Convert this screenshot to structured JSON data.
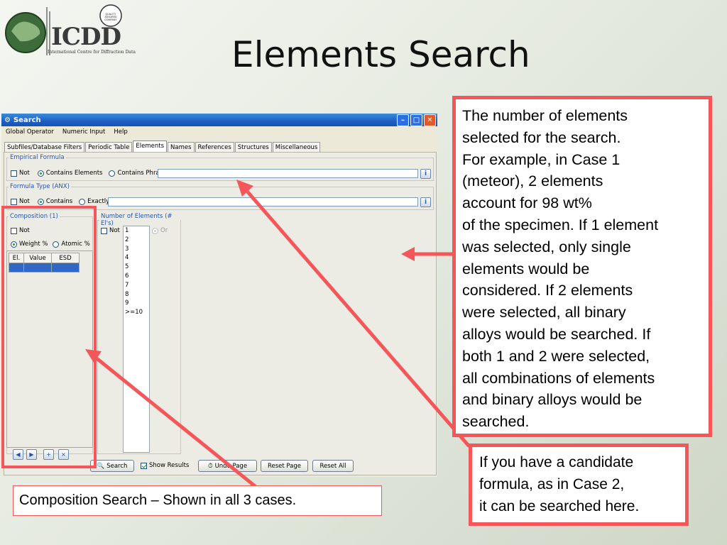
{
  "slide": {
    "title": "Elements Search",
    "logo": {
      "text": "ICDD",
      "subtitle": "International Centre for Diffraction Data",
      "badge": "QUALITY ASSURED COMPANY"
    }
  },
  "window": {
    "title": "Search",
    "menu": [
      "Global Operator",
      "Numeric Input",
      "Help"
    ],
    "tabs": [
      "Subfiles/Database Filters",
      "Periodic Table",
      "Elements",
      "Names",
      "References",
      "Structures",
      "Miscellaneous"
    ],
    "active_tab": "Elements",
    "empirical": {
      "legend": "Empirical Formula",
      "not_label": "Not",
      "contains_elements_label": "Contains Elements",
      "contains_phrase_label": "Contains Phrase",
      "value": ""
    },
    "formula_type": {
      "legend": "Formula Type (ANX)",
      "not_label": "Not",
      "contains_label": "Contains",
      "exactly_label": "Exactly",
      "value": ""
    },
    "composition": {
      "legend": "Composition (1)",
      "not_label": "Not",
      "weight_label": "Weight %",
      "atomic_label": "Atomic %",
      "columns": [
        "El.",
        "Value",
        "ESD"
      ]
    },
    "num_elements": {
      "legend": "Number of Elements (# El's)",
      "not_label": "Not",
      "or_label": "Or",
      "items": [
        "1",
        "2",
        "3",
        "4",
        "5",
        "6",
        "7",
        "8",
        "9",
        ">=10"
      ]
    },
    "buttons": {
      "search": "Search",
      "show_results": "Show Results",
      "undo": "Undo Page",
      "reset_page": "Reset Page",
      "reset_all": "Reset All"
    }
  },
  "callouts": {
    "elements_count": [
      "The number of elements",
      "selected for the search.",
      "For example, in Case 1",
      "(meteor), 2 elements",
      "account for 98 wt%",
      "of the specimen. If 1 element",
      "was selected, only single",
      "elements would be",
      "considered. If 2 elements",
      "were selected, all binary",
      "alloys would be searched. If",
      "both 1 and 2 were selected,",
      "all combinations of elements",
      "and binary alloys would be",
      "searched."
    ],
    "formula": [
      "If you have a candidate",
      "formula, as in Case 2,",
      "it can be searched here."
    ],
    "composition": "Composition Search – Shown in all 3 cases."
  },
  "colors": {
    "accent_red": "#f4565a",
    "xp_blue": "#1b5fc8",
    "selection": "#3167c5"
  }
}
